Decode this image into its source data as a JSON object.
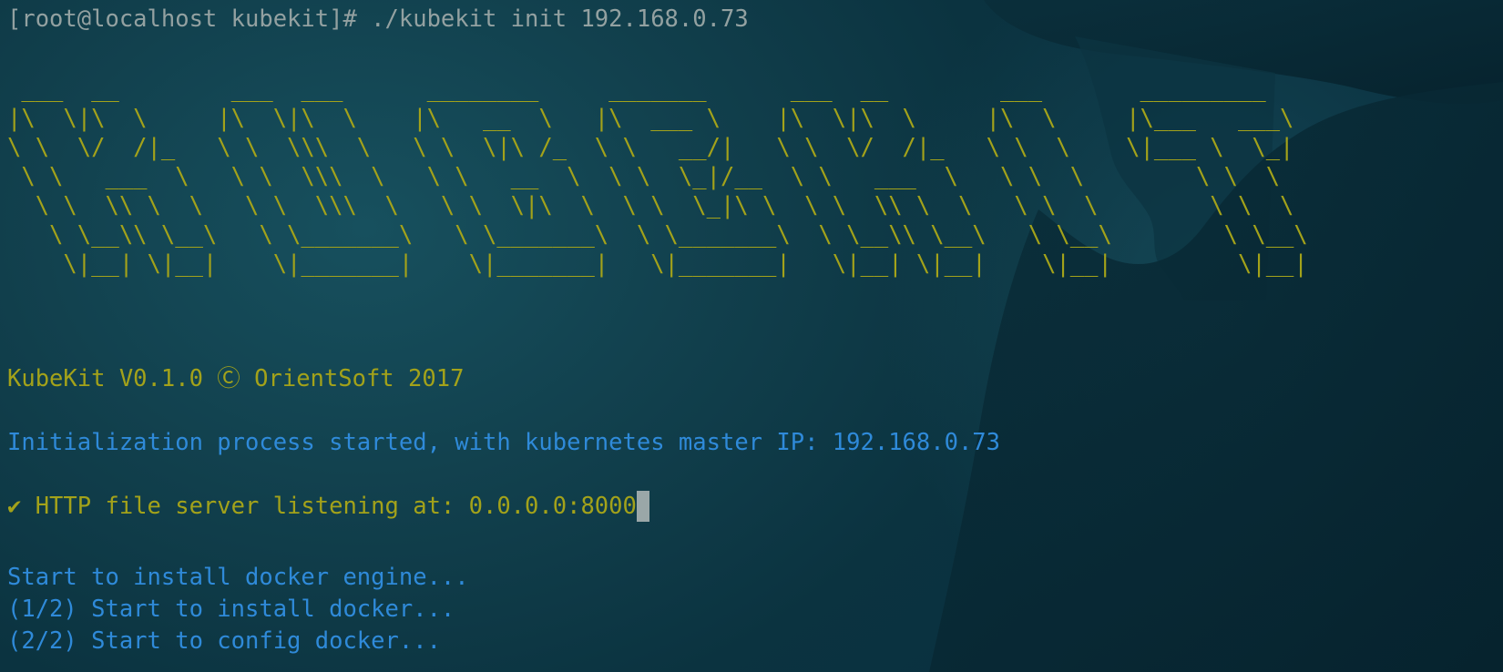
{
  "terminal": {
    "prompt_line": "[root@localhost kubekit]# ./kubekit init 192.168.0.73",
    "banner_lines": [
      " ___  __        ___  ___      ________     _______      ___  __        ___       _________",
      "|\\  \\|\\  \\     |\\  \\|\\  \\    |\\   __  \\   |\\  ___ \\    |\\  \\|\\  \\     |\\  \\     |\\___   ___\\",
      "\\ \\  \\/  /|_   \\ \\  \\\\\\  \\   \\ \\  \\|\\ /_  \\ \\   __/|   \\ \\  \\/  /|_   \\ \\  \\    \\|___ \\  \\_|",
      " \\ \\   ___  \\   \\ \\  \\\\\\  \\   \\ \\   __  \\  \\ \\  \\_|/__  \\ \\   ___  \\   \\ \\  \\        \\ \\  \\",
      "  \\ \\  \\\\ \\  \\   \\ \\  \\\\\\  \\   \\ \\  \\|\\  \\  \\ \\  \\_|\\ \\  \\ \\  \\\\ \\  \\   \\ \\  \\        \\ \\  \\",
      "   \\ \\__\\\\ \\__\\   \\ \\_______\\   \\ \\_______\\  \\ \\_______\\  \\ \\__\\\\ \\__\\   \\ \\__\\        \\ \\__\\",
      "    \\|__| \\|__|    \\|_______|    \\|_______|   \\|_______|   \\|__| \\|__|    \\|__|         \\|__|"
    ],
    "copyright": "KubeKit V0.1.0 Ⓒ OrientSoft 2017",
    "init_message": "Initialization process started, with kubernetes master IP: 192.168.0.73",
    "server_message": "✔ HTTP file server listening at: 0.0.0.0:8000",
    "docker_messages": [
      "Start to install docker engine...",
      "(1/2) Start to install docker...",
      "(2/2) Start to config docker..."
    ]
  },
  "colors": {
    "background": "#0b3340",
    "prompt_text": "#93a1a1",
    "yellow_text": "#a3a21a",
    "blue_text": "#2f8ad9",
    "cursor": "#9aa7a8"
  }
}
